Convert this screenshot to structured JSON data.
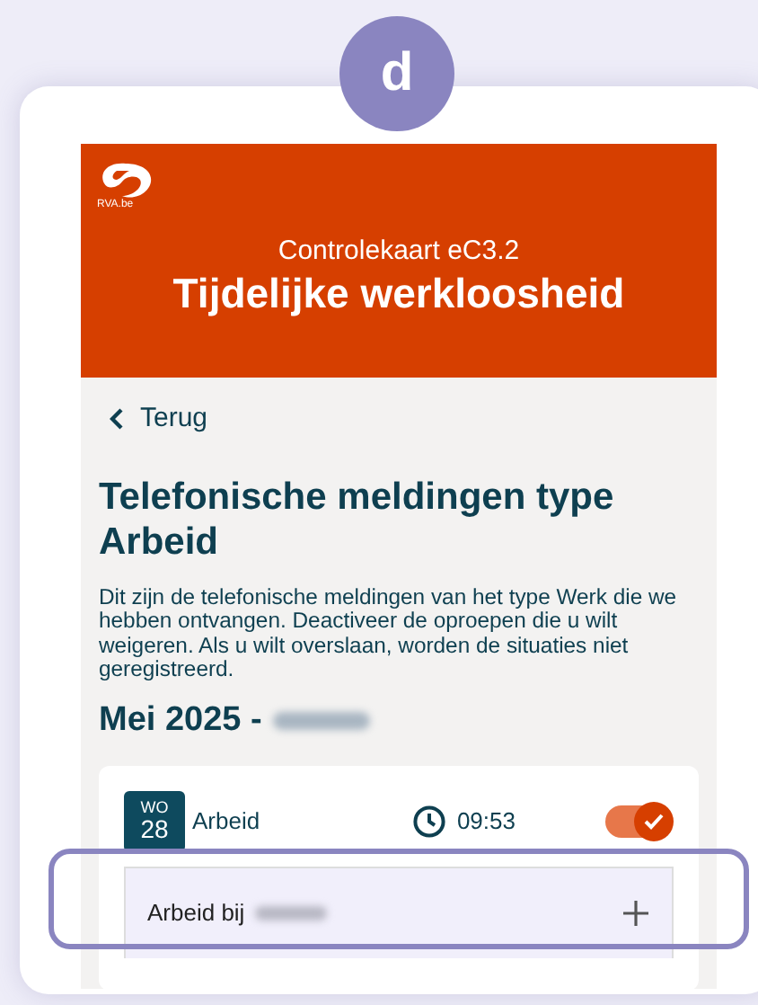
{
  "badge": "d",
  "header": {
    "logo_text": "RVA.be",
    "subtitle": "Controlekaart eC3.2",
    "title": "Tijdelijke werkloosheid"
  },
  "back_link": "Terug",
  "heading": "Telefonische meldingen type Arbeid",
  "description": "Dit zijn de telefonische meldingen van het type Werk die we hebben ontvangen. Deactiveer de oproepen die u wilt weigeren. Als u wilt overslaan, worden de situaties niet geregistreerd.",
  "month": "Mei 2025 -",
  "entries": [
    {
      "weekday": "WO",
      "day": "28",
      "type": "Arbeid",
      "time": "09:53",
      "on": true,
      "details": [
        {
          "label": "Arbeid bij",
          "expanded": false
        }
      ]
    }
  ]
}
